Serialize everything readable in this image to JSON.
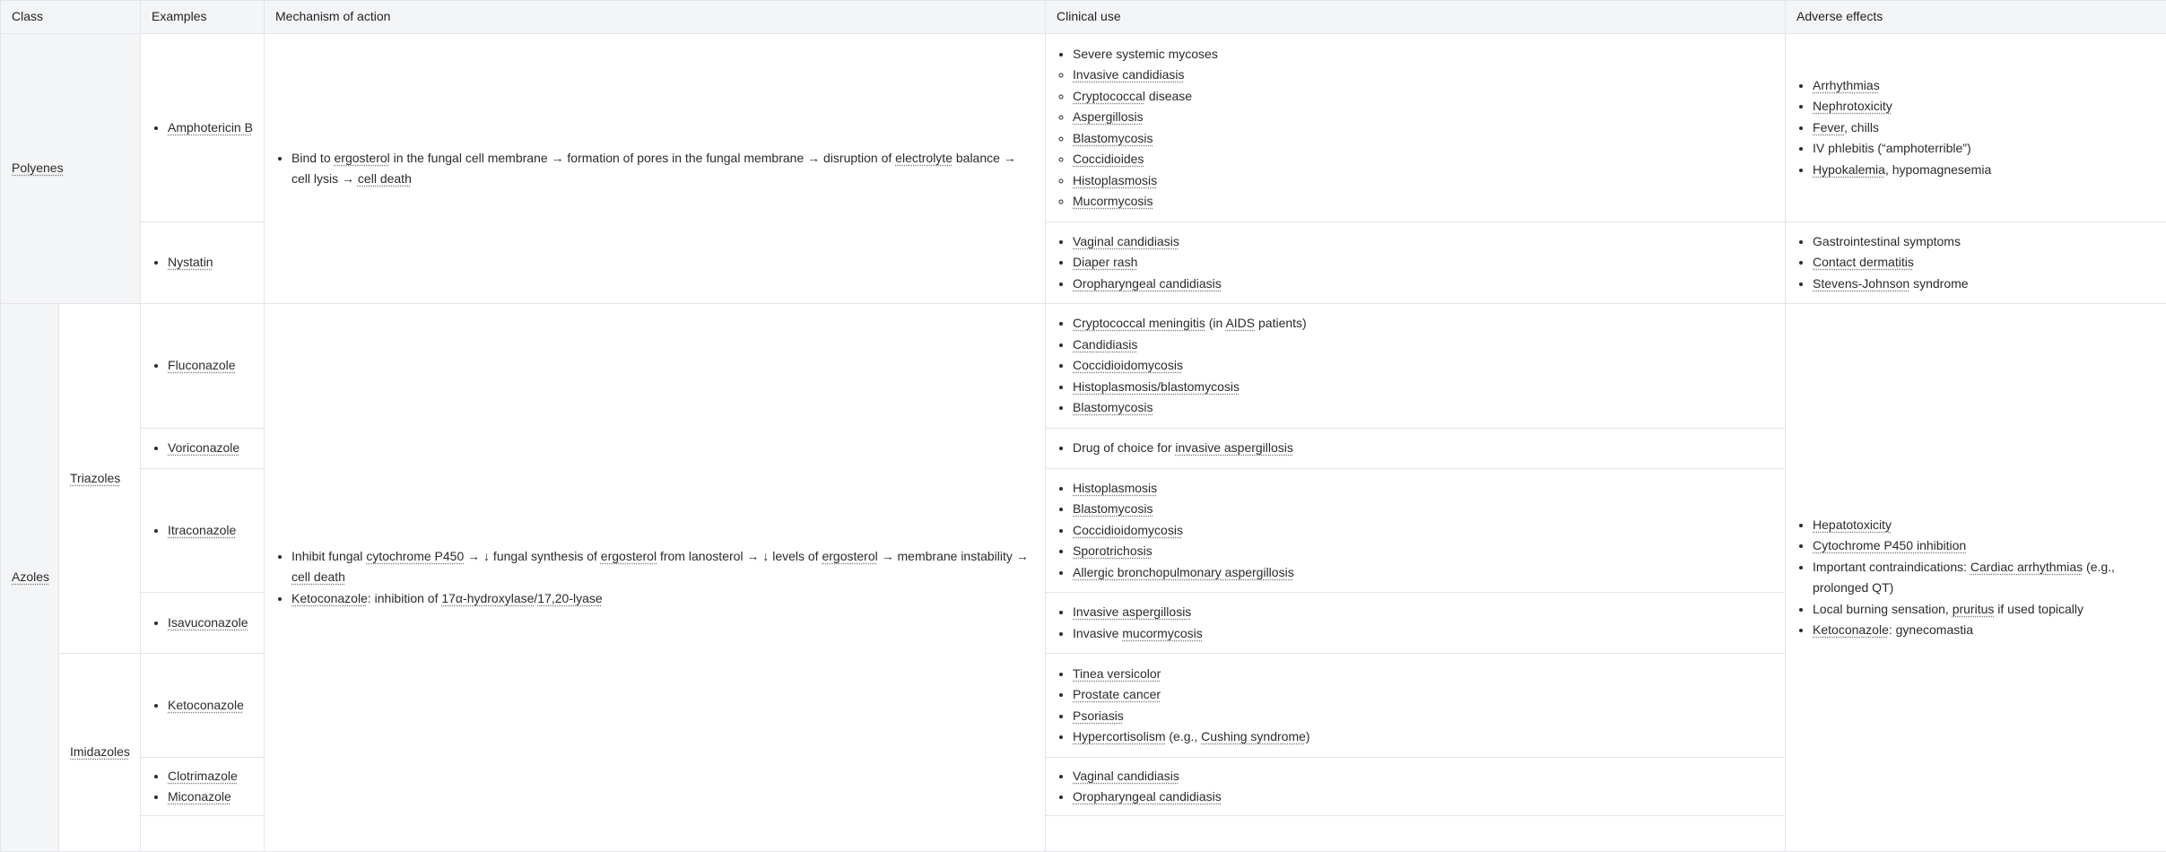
{
  "headers": {
    "class": "Class",
    "examples": "Examples",
    "mechanism": "Mechanism of action",
    "clinical": "Clinical use",
    "adverse": "Adverse effects"
  },
  "polyenes": {
    "class": "Polyenes",
    "ampho": "Amphotericin B",
    "nystatin": "Nystatin",
    "mech": [
      [
        {
          "t": "Bind to "
        },
        {
          "t": "ergosterol",
          "u": 1
        },
        {
          "t": " in the fungal cell membrane → formation of pores in the fungal membrane → disruption of "
        },
        {
          "t": "electrolyte",
          "u": 1
        },
        {
          "t": " balance → cell lysis → "
        },
        {
          "t": "cell death",
          "u": 1
        }
      ]
    ],
    "ampho_clinical_main": [
      [
        {
          "t": "Severe systemic mycoses"
        }
      ]
    ],
    "ampho_clinical_sub": [
      [
        {
          "t": "Invasive candidiasis",
          "u": 1
        }
      ],
      [
        {
          "t": "Cryptococcal",
          "u": 1
        },
        {
          "t": " disease"
        }
      ],
      [
        {
          "t": "Aspergillosis",
          "u": 1
        }
      ],
      [
        {
          "t": "Blastomycosis",
          "u": 1
        }
      ],
      [
        {
          "t": "Coccidioides",
          "u": 1
        }
      ],
      [
        {
          "t": "Histoplasmosis",
          "u": 1
        }
      ],
      [
        {
          "t": "Mucormycosis",
          "u": 1
        }
      ]
    ],
    "ampho_adverse": [
      [
        {
          "t": "Arrhythmias",
          "u": 1
        }
      ],
      [
        {
          "t": "Nephrotoxicity",
          "u": 1
        }
      ],
      [
        {
          "t": "Fever",
          "u": 1
        },
        {
          "t": ", chills"
        }
      ],
      [
        {
          "t": "IV phlebitis (“amphoterrible”)"
        }
      ],
      [
        {
          "t": "Hypokalemia",
          "u": 1
        },
        {
          "t": ", hypomagnesemia"
        }
      ]
    ],
    "nystatin_clinical": [
      [
        {
          "t": "Vaginal candidiasis",
          "u": 1
        }
      ],
      [
        {
          "t": "Diaper rash",
          "u": 1
        }
      ],
      [
        {
          "t": "Oropharyngeal candidiasis",
          "u": 1
        }
      ]
    ],
    "nystatin_adverse": [
      [
        {
          "t": "Gastrointestinal symptoms"
        }
      ],
      [
        {
          "t": "Contact dermatitis",
          "u": 1
        }
      ],
      [
        {
          "t": "Stevens-Johnson",
          "u": 1
        },
        {
          "t": " syndrome"
        }
      ]
    ]
  },
  "azoles": {
    "class": "Azoles",
    "triazoles": "Triazoles",
    "imidazoles": "Imidazoles",
    "fluconazole": "Fluconazole",
    "voriconazole": "Voriconazole",
    "itraconazole": "Itraconazole",
    "isavuconazole": "Isavuconazole",
    "ketoconazole": "Ketoconazole",
    "clotrimazole": "Clotrimazole",
    "miconazole": "Miconazole",
    "mech": [
      [
        {
          "t": "Inhibit fungal "
        },
        {
          "t": "cytochrome P450",
          "u": 1
        },
        {
          "t": " → ↓ fungal synthesis of "
        },
        {
          "t": "ergosterol",
          "u": 1
        },
        {
          "t": " from lanosterol → ↓ levels of "
        },
        {
          "t": "ergosterol",
          "u": 1
        },
        {
          "t": " → membrane instability → "
        },
        {
          "t": "cell death",
          "u": 1
        }
      ],
      [
        {
          "t": "Ketoconazole",
          "u": 1
        },
        {
          "t": ": inhibition of "
        },
        {
          "t": "17α-hydroxylase",
          "u": 1
        },
        {
          "t": "/"
        },
        {
          "t": "17,20-lyase",
          "u": 1
        }
      ]
    ],
    "flu_clinical": [
      [
        {
          "t": "Cryptococcal meningitis",
          "u": 1
        },
        {
          "t": " (in "
        },
        {
          "t": "AIDS",
          "u": 1
        },
        {
          "t": " patients)"
        }
      ],
      [
        {
          "t": "Candidiasis",
          "u": 1
        }
      ],
      [
        {
          "t": "Coccidioidomycosis",
          "u": 1
        }
      ],
      [
        {
          "t": "Histoplasmosis/blastomycosis",
          "u": 1
        }
      ],
      [
        {
          "t": "Blastomycosis",
          "u": 1
        }
      ]
    ],
    "vori_clinical": [
      [
        {
          "t": "Drug of choice for "
        },
        {
          "t": "invasive aspergillosis",
          "u": 1
        }
      ]
    ],
    "itra_clinical": [
      [
        {
          "t": "Histoplasmosis",
          "u": 1
        }
      ],
      [
        {
          "t": "Blastomycosis",
          "u": 1
        }
      ],
      [
        {
          "t": "Coccidioidomycosis",
          "u": 1
        }
      ],
      [
        {
          "t": "Sporotrichosis",
          "u": 1
        }
      ],
      [
        {
          "t": "Allergic bronchopulmonary aspergillosis",
          "u": 1
        }
      ]
    ],
    "isa_clinical": [
      [
        {
          "t": "Invasive aspergillosis",
          "u": 1
        }
      ],
      [
        {
          "t": "Invasive "
        },
        {
          "t": "mucormycosis",
          "u": 1
        }
      ]
    ],
    "keto_clinical": [
      [
        {
          "t": "Tinea versicolor",
          "u": 1
        }
      ],
      [
        {
          "t": "Prostate cancer",
          "u": 1
        }
      ],
      [
        {
          "t": "Psoriasis",
          "u": 1
        }
      ],
      [
        {
          "t": "Hypercortisolism",
          "u": 1
        },
        {
          "t": " (e.g., "
        },
        {
          "t": "Cushing syndrome",
          "u": 1
        },
        {
          "t": ")"
        }
      ]
    ],
    "clo_clinical": [
      [
        {
          "t": "Vaginal candidiasis",
          "u": 1
        }
      ],
      [
        {
          "t": "Oropharyngeal candidiasis",
          "u": 1
        }
      ]
    ],
    "adverse": [
      [
        {
          "t": "Hepatotoxicity",
          "u": 1
        }
      ],
      [
        {
          "t": "Cytochrome P450 inhibition",
          "u": 1
        }
      ],
      [
        {
          "t": "Important contraindications: "
        },
        {
          "t": "Cardiac arrhythmias",
          "u": 1
        },
        {
          "t": " (e.g., prolonged QT)"
        }
      ],
      [
        {
          "t": "Local burning sensation, "
        },
        {
          "t": "pruritus",
          "u": 1
        },
        {
          "t": " if used topically"
        }
      ],
      [
        {
          "t": "Ketoconazole",
          "u": 1
        },
        {
          "t": ": gynecomastia"
        }
      ]
    ]
  }
}
